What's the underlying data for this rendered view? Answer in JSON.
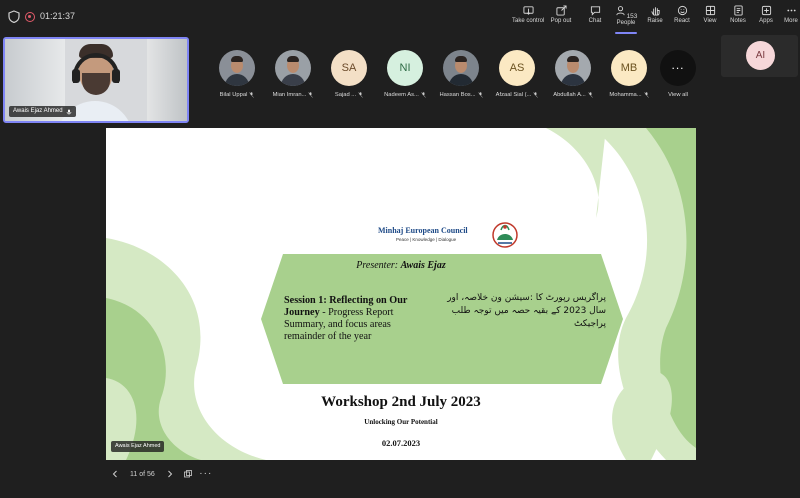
{
  "topbar": {
    "timer": "01:21:37",
    "buttons": [
      {
        "label": "Take control",
        "icon": "take-control-icon"
      },
      {
        "label": "Pop out",
        "icon": "pop-out-icon"
      },
      {
        "label": "Chat",
        "icon": "chat-icon"
      },
      {
        "label": "People",
        "icon": "people-icon",
        "count": "153",
        "active": true
      },
      {
        "label": "Raise",
        "icon": "raise-hand-icon"
      },
      {
        "label": "React",
        "icon": "react-icon"
      },
      {
        "label": "View",
        "icon": "view-icon"
      },
      {
        "label": "Notes",
        "icon": "notes-icon"
      },
      {
        "label": "Apps",
        "icon": "apps-icon"
      },
      {
        "label": "More",
        "icon": "more-icon"
      }
    ]
  },
  "self_video": {
    "name": "Awais Ejaz Ahmed"
  },
  "participants": [
    {
      "name": "Bilal Uppal",
      "initials": "",
      "photo": true
    },
    {
      "name": "Mian Imran...",
      "initials": "",
      "photo": true
    },
    {
      "name": "Sajad ...",
      "initials": "SA",
      "photo": false,
      "color": "#f3dfc6"
    },
    {
      "name": "Nadeem As...",
      "initials": "NI",
      "photo": false,
      "color": "#d6f0df"
    },
    {
      "name": "Hassan Bos...",
      "initials": "",
      "photo": true
    },
    {
      "name": "Afzaal Sial (...",
      "initials": "AS",
      "photo": false,
      "color": "#fbe9c3"
    },
    {
      "name": "Abdullah A...",
      "initials": "",
      "photo": true
    },
    {
      "name": "Mohamma...",
      "initials": "MB",
      "photo": false,
      "color": "#fbe9c3"
    }
  ],
  "view_all": {
    "label": "View all",
    "symbol": "..."
  },
  "ai_panel": {
    "initials": "AI"
  },
  "slide": {
    "logo_title": "Minhaj European Council",
    "logo_subtitle": "Peace | Knowledge | Dialogue",
    "presenter_prefix": "Presenter: ",
    "presenter_name": "Awais Ejaz",
    "session_title": "Session 1: Reflecting on Our Journey",
    "session_rest": " - Progress Report Summary, and focus areas remainder of the year",
    "urdu_text": "پراگریس رپورٹ کا :سیشن ون خلاصہ، اور سال 2023 کے بقیہ حصہ میں توجہ طلب پراجیکٹ",
    "workshop_title": "Workshop 2nd July 2023",
    "workshop_subtitle": "Unlocking Our Potential",
    "workshop_date": "02.07.2023",
    "presenter_tag": "Awais Ejaz Ahmed",
    "colors": {
      "light_green": "#d5e9c4",
      "mid_green": "#a8d08d"
    }
  },
  "pager": {
    "current": "11 of 56"
  }
}
